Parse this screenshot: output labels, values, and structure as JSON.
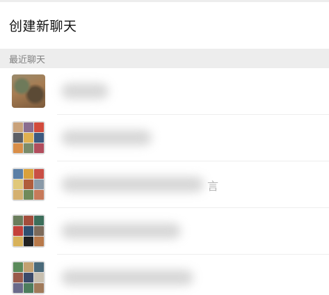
{
  "create_chat": {
    "label": "创建新聊天"
  },
  "recent_section": {
    "title": "最近聊天"
  },
  "chats": [
    {
      "avatar_type": "photo",
      "colors": []
    },
    {
      "avatar_type": "group",
      "colors": [
        "#c9a27a",
        "#8a6d8f",
        "#d24b3c",
        "#5c5f66",
        "#e0b050",
        "#3d5a80",
        "#d98e48",
        "#7a8b6a",
        "#b24d5d"
      ]
    },
    {
      "avatar_type": "group",
      "colors": [
        "#5b7fa6",
        "#d9a13b",
        "#c94f45",
        "#e0c87a",
        "#b05d3c",
        "#8a9aa8",
        "#d4b070",
        "#6f8a5a",
        "#c77a5a"
      ]
    },
    {
      "avatar_type": "group",
      "colors": [
        "#6a7d5c",
        "#a34d3c",
        "#3c6e5a",
        "#c4413b",
        "#2f4f6f",
        "#7c6a5a",
        "#d8b25a",
        "#222222",
        "#b8794a"
      ]
    },
    {
      "avatar_type": "group",
      "colors": [
        "#5a8a5a",
        "#c2a070",
        "#4a6a7a",
        "#9a5a4a",
        "#3a4a6a",
        "#c8c0b0",
        "#6a6a8a",
        "#4d7d5d",
        "#a07a5a"
      ]
    }
  ],
  "partial_text": "言"
}
